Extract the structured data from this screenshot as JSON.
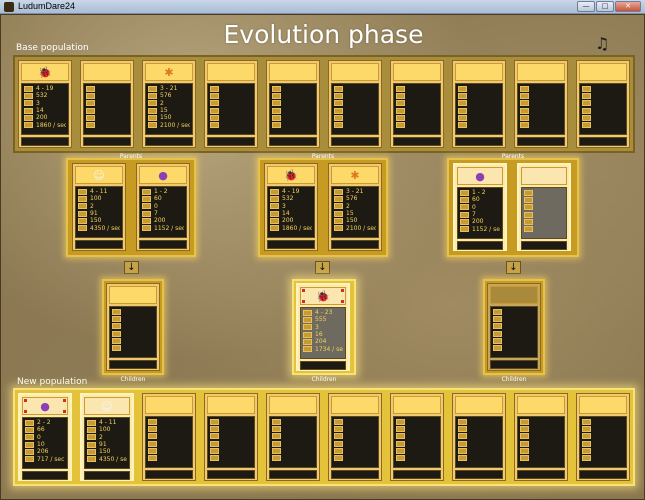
{
  "window": {
    "title": "LudumDare24",
    "btn_min": "—",
    "btn_max": "□",
    "btn_close": "✕"
  },
  "phase_title": "Evolution phase",
  "music_icon": "♫",
  "labels": {
    "base_population": "Base population",
    "new_population": "New population",
    "parents": "Parents",
    "children": "Children"
  },
  "colors": {
    "panel": "#a88e3c",
    "panel_highlight": "#c79a22",
    "card": "#f2c870",
    "stat_text": "#f3d35e"
  },
  "base_population": [
    {
      "creature": "red-bug-icon",
      "stats": [
        "4 - 19",
        "532",
        "3",
        "14",
        "200",
        "1860 / sec"
      ]
    },
    {
      "creature": "",
      "stats": [
        "",
        "",
        "",
        "",
        "",
        ""
      ]
    },
    {
      "creature": "orange-bug-icon",
      "stats": [
        "3 - 21",
        "576",
        "2",
        "15",
        "150",
        "2100 / sec"
      ]
    },
    {
      "creature": "",
      "stats": [
        "",
        "",
        "",
        "",
        "",
        ""
      ]
    },
    {
      "creature": "",
      "stats": [
        "",
        "",
        "",
        "",
        "",
        ""
      ]
    },
    {
      "creature": "",
      "stats": [
        "",
        "",
        "",
        "",
        "",
        ""
      ]
    },
    {
      "creature": "",
      "stats": [
        "",
        "",
        "",
        "",
        "",
        ""
      ]
    },
    {
      "creature": "",
      "stats": [
        "",
        "",
        "",
        "",
        "",
        ""
      ]
    },
    {
      "creature": "",
      "stats": [
        "",
        "",
        "",
        "",
        "",
        ""
      ]
    },
    {
      "creature": "",
      "stats": [
        "",
        "",
        "",
        "",
        "",
        ""
      ]
    }
  ],
  "breeding": [
    {
      "parents": [
        {
          "creature": "white-ghost-icon",
          "stats": [
            "4 - 11",
            "100",
            "2",
            "91",
            "150",
            "4350 / sec"
          ]
        },
        {
          "creature": "purple-bug-icon",
          "stats": [
            "1 - 2",
            "60",
            "0",
            "7",
            "200",
            "1152 / sec"
          ]
        }
      ],
      "child": {
        "creature": "",
        "stats": [
          "",
          "",
          "",
          "",
          "",
          ""
        ]
      }
    },
    {
      "parents": [
        {
          "creature": "red-bug-icon",
          "stats": [
            "4 - 19",
            "532",
            "3",
            "14",
            "200",
            "1860 / sec"
          ]
        },
        {
          "creature": "orange-bug-icon",
          "stats": [
            "3 - 21",
            "576",
            "2",
            "15",
            "150",
            "2100 / sec"
          ]
        }
      ],
      "child": {
        "creature": "red-bug-icon",
        "stats": [
          "4 - 23",
          "555",
          "3",
          "16",
          "204",
          "1734 / sec"
        ]
      }
    },
    {
      "parents": [
        {
          "creature": "purple-bug-icon",
          "stats": [
            "1 - 2",
            "60",
            "0",
            "7",
            "200",
            "1152 / sec"
          ]
        },
        {
          "creature": "",
          "stats": [
            "",
            "",
            "",
            "",
            "",
            ""
          ]
        }
      ],
      "child": {
        "creature": "",
        "stats": [
          "",
          "",
          "",
          "",
          "",
          ""
        ]
      }
    }
  ],
  "new_population": [
    {
      "creature": "purple-bug-icon",
      "stats": [
        "2 - 2",
        "66",
        "0",
        "10",
        "206",
        "717 / sec"
      ]
    },
    {
      "creature": "white-ghost-icon",
      "stats": [
        "4 - 11",
        "100",
        "2",
        "91",
        "150",
        "4350 / sec"
      ]
    },
    {
      "creature": "",
      "stats": [
        "",
        "",
        "",
        "",
        "",
        ""
      ]
    },
    {
      "creature": "",
      "stats": [
        "",
        "",
        "",
        "",
        "",
        ""
      ]
    },
    {
      "creature": "",
      "stats": [
        "",
        "",
        "",
        "",
        "",
        ""
      ]
    },
    {
      "creature": "",
      "stats": [
        "",
        "",
        "",
        "",
        "",
        ""
      ]
    },
    {
      "creature": "",
      "stats": [
        "",
        "",
        "",
        "",
        "",
        ""
      ]
    },
    {
      "creature": "",
      "stats": [
        "",
        "",
        "",
        "",
        "",
        ""
      ]
    },
    {
      "creature": "",
      "stats": [
        "",
        "",
        "",
        "",
        "",
        ""
      ]
    },
    {
      "creature": "",
      "stats": [
        "",
        "",
        "",
        "",
        "",
        ""
      ]
    }
  ],
  "arrow_glyph": "↓"
}
